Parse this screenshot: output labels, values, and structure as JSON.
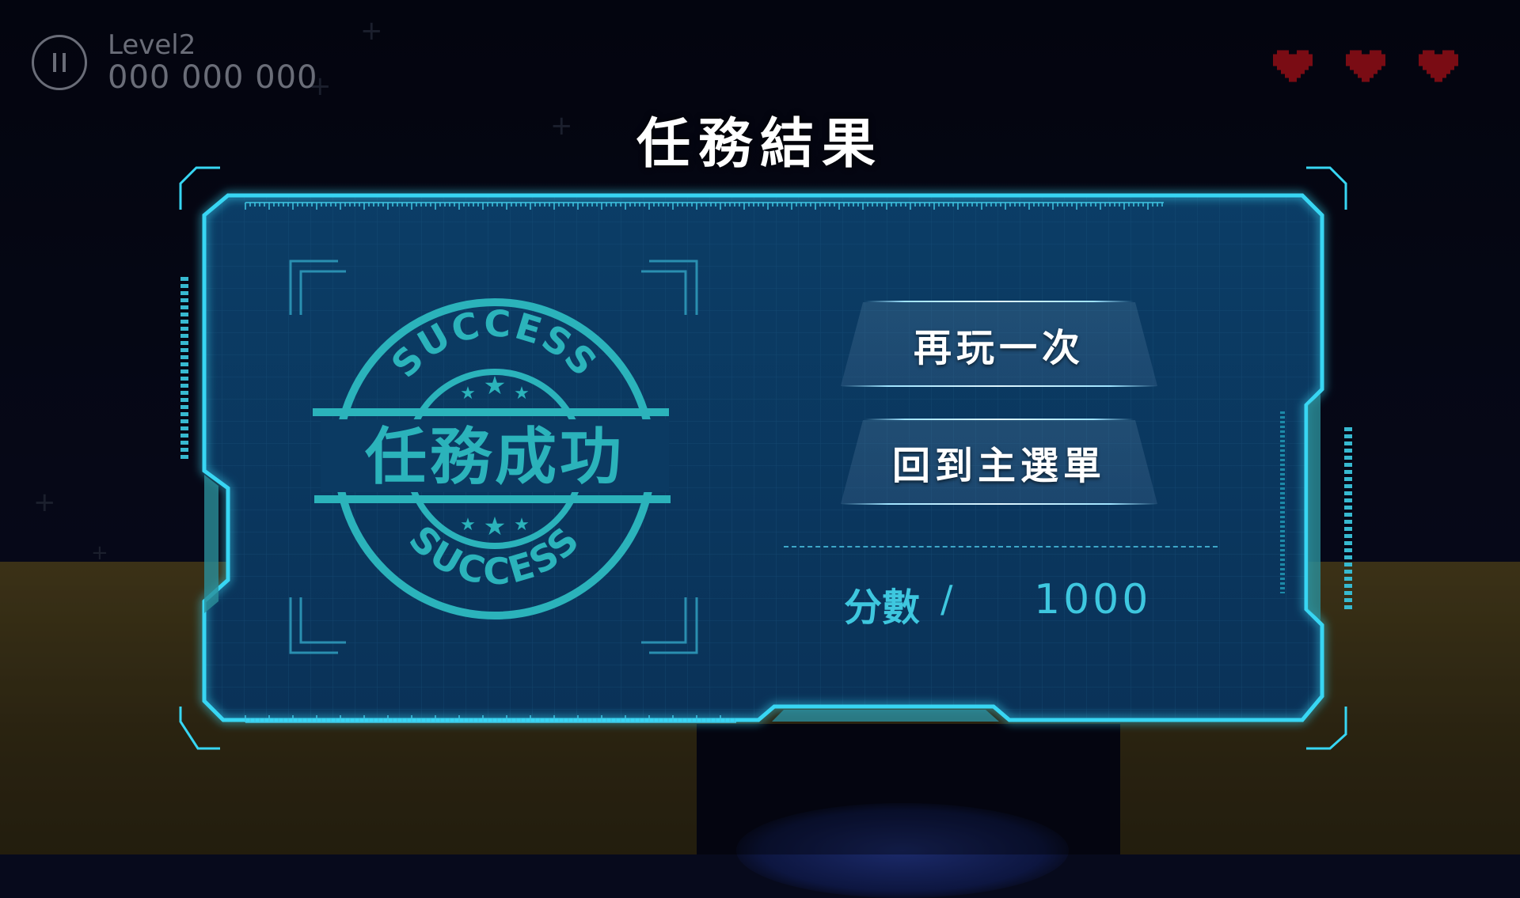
{
  "hud": {
    "level": "Level2",
    "score": "000 000 000",
    "lives": 3
  },
  "title": "任務結果",
  "stamp": {
    "top_text": "SUCCESS",
    "main_text": "任務成功",
    "bottom_text": "SUCCESS"
  },
  "buttons": {
    "play_again": "再玩一次",
    "main_menu": "回到主選單"
  },
  "score": {
    "label": "分數",
    "separator": "/",
    "value": "1000"
  },
  "colors": {
    "accent": "#3ec7df",
    "panel_border": "#37d6f3",
    "heart": "#7a0c14"
  }
}
